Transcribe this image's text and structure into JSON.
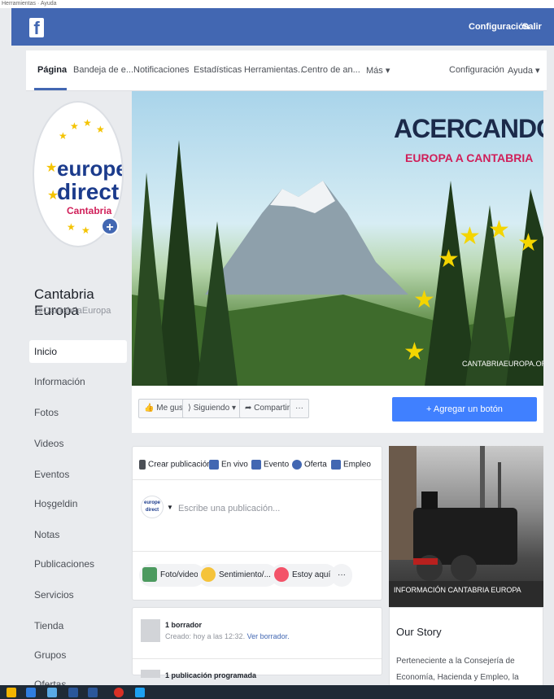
{
  "browser": {
    "bookmarks": "Herramientas · Ayuda"
  },
  "topbar": {
    "logo": "f",
    "links": [
      "Configuración",
      "Salir"
    ]
  },
  "page_nav": {
    "items": [
      "Página",
      "Bandeja de e...",
      "Notificaciones",
      "Estadísticas",
      "Herramientas...",
      "Centro de an...",
      "Más ▾",
      "Configuración",
      "Ayuda ▾"
    ]
  },
  "profile": {
    "logo_words": [
      "europe",
      "direct",
      "Cantabria"
    ],
    "name": "Cantabria Europa",
    "handle": "@CantabriaEuropa"
  },
  "sidebar": {
    "items": [
      "Inicio",
      "Información",
      "Fotos",
      "Videos",
      "Eventos",
      "Hoşgeldin",
      "Notas",
      "Publicaciones",
      "Servicios",
      "Tienda",
      "Grupos",
      "Ofertas"
    ]
  },
  "cover": {
    "title": "ACERCANDO",
    "subtitle": "EUROPA A CANTABRIA",
    "site": "CANTABRIAEUROPA.ORG"
  },
  "actions": {
    "like": "Me gusta",
    "following": "Siguiendo ▾",
    "share": "Compartir",
    "more": "···",
    "add_button": "+ Agregar un botón"
  },
  "composer": {
    "tabs": [
      "Crear publicación",
      "En vivo",
      "Evento",
      "Oferta",
      "Empleo"
    ],
    "placeholder": "Escribe una publicación...",
    "mini_logo": "europe direct",
    "options": [
      "Foto/video",
      "Sentimiento/...",
      "Estoy aquí"
    ],
    "more": "···"
  },
  "drafts": {
    "title": "1 borrador",
    "subtitle": "Creado: hoy a las 12:32.",
    "link": "Ver borrador.",
    "scheduled": "1 publicación programada"
  },
  "photo": {
    "caption": "INFORMACIÓN CANTABRIA EUROPA"
  },
  "story": {
    "title": "Our Story",
    "text": "Perteneciente a la Consejería de Economía, Hacienda y Empleo, la Dirección General de"
  },
  "colors": {
    "brand": "#4267b2",
    "accent": "#4080ff",
    "highlight": "#d01f59",
    "star": "#f4d500"
  }
}
